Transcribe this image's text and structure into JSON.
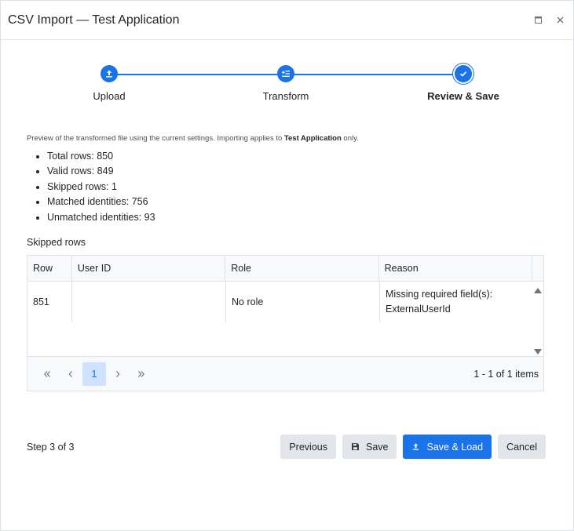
{
  "window": {
    "title": "CSV Import — Test Application"
  },
  "stepper": {
    "steps": [
      {
        "label": "Upload",
        "icon": "upload-icon",
        "state": "complete"
      },
      {
        "label": "Transform",
        "icon": "transform-icon",
        "state": "complete"
      },
      {
        "label": "Review & Save",
        "icon": "check-icon",
        "state": "current"
      }
    ]
  },
  "preview": {
    "text_before": "Preview of the transformed file using the current settings. Importing applies to ",
    "app_name": "Test Application",
    "text_after": " only."
  },
  "stats": [
    "Total rows: 850",
    "Valid rows: 849",
    "Skipped rows: 1",
    "Matched identities: 756",
    "Unmatched identities: 93"
  ],
  "skipped": {
    "title": "Skipped rows",
    "columns": [
      "Row",
      "User ID",
      "Role",
      "Reason"
    ],
    "rows": [
      {
        "row": "851",
        "user_id": "",
        "role": "No role",
        "reason": "Missing required field(s): ExternalUserId"
      }
    ]
  },
  "pager": {
    "current_page": "1",
    "info": "1 - 1 of 1 items"
  },
  "footer": {
    "step_text": "Step 3 of 3",
    "previous_label": "Previous",
    "save_label": "Save",
    "save_load_label": "Save & Load",
    "cancel_label": "Cancel"
  },
  "colors": {
    "primary": "#1a73e8",
    "secondary_button": "#e2e6ea"
  }
}
